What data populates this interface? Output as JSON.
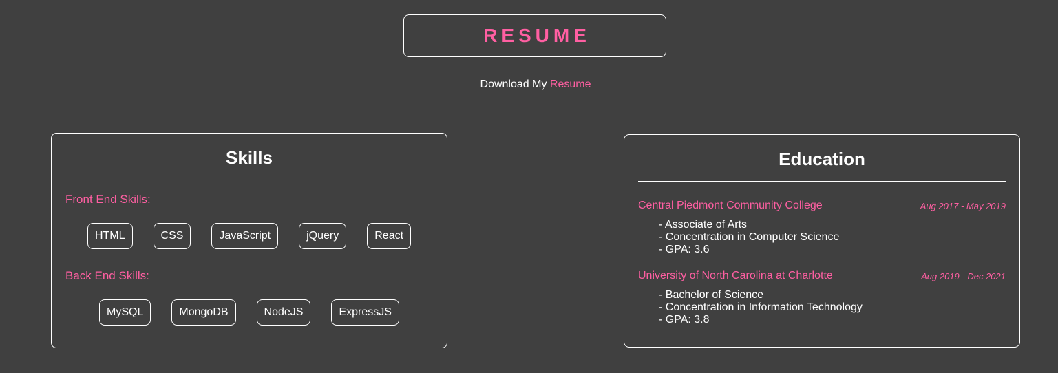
{
  "header": {
    "title": "RESUME",
    "download_prefix": "Download My",
    "download_link": "Resume"
  },
  "skills": {
    "heading": "Skills",
    "front_label": "Front End Skills:",
    "front": [
      "HTML",
      "CSS",
      "JavaScript",
      "jQuery",
      "React"
    ],
    "back_label": "Back End Skills:",
    "back": [
      "MySQL",
      "MongoDB",
      "NodeJS",
      "ExpressJS"
    ]
  },
  "education": {
    "heading": "Education",
    "entries": [
      {
        "school": "Central Piedmont Community College",
        "dates": "Aug 2017 - May 2019",
        "details": [
          "- Associate of Arts",
          "- Concentration in Computer Science",
          "- GPA: 3.6"
        ]
      },
      {
        "school": "University of North Carolina at Charlotte",
        "dates": "Aug 2019 - Dec 2021",
        "details": [
          "- Bachelor of Science",
          "- Concentration in Information Technology",
          "- GPA: 3.8"
        ]
      }
    ]
  },
  "colors": {
    "background": "#404040",
    "accent": "#ff5fa2",
    "text": "#ffffff"
  }
}
